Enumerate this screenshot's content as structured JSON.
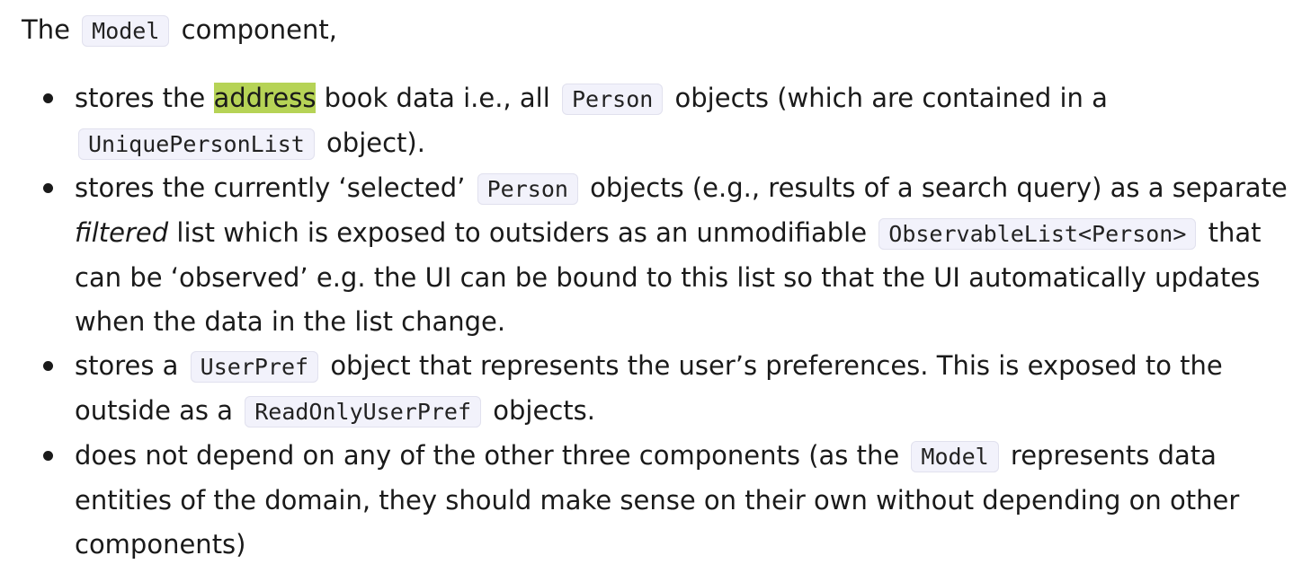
{
  "intro": {
    "prefix": "The",
    "code": "Model",
    "suffix": "component,"
  },
  "items": [
    {
      "t1": "stores the",
      "highlight": "address",
      "t2": "book data i.e., all",
      "code1": "Person",
      "t3": "objects (which are contained in a",
      "code2": "UniquePersonList",
      "t4": "object)."
    },
    {
      "t1": "stores the currently ‘selected’",
      "code1": "Person",
      "t2": "objects (e.g., results of a search query) as a separate",
      "em": "filtered",
      "t3": "list which is exposed to outsiders as an unmodifiable",
      "code2": "ObservableList<Person>",
      "t4": "that can be ‘observed’ e.g. the UI can be bound to this list so that the UI automatically updates when the data in the list change."
    },
    {
      "t1": "stores a",
      "code1": "UserPref",
      "t2": "object that represents the user’s preferences. This is exposed to the outside as a",
      "code2": "ReadOnlyUserPref",
      "t3": "objects."
    },
    {
      "t1": "does not depend on any of the other three components (as the",
      "code1": "Model",
      "t2": "represents data entities of the domain, they should make sense on their own without depending on other components)"
    }
  ]
}
